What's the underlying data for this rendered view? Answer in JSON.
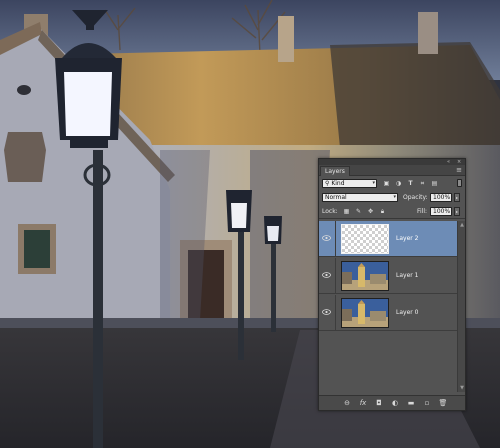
{
  "panel": {
    "title_tab": "Layers",
    "menu_icon": "panel-menu-icon",
    "collapse_icons": [
      "collapse-icon",
      "close-icon"
    ],
    "filter": {
      "kind_label": "Kind",
      "filter_icons": [
        "pixel-filter-icon",
        "adjustment-filter-icon",
        "type-filter-icon",
        "shape-filter-icon",
        "smart-object-filter-icon"
      ]
    },
    "blend": {
      "mode": "Normal",
      "opacity_label": "Opacity:",
      "opacity_value": "100%"
    },
    "lock": {
      "label": "Lock:",
      "icons": [
        "lock-transparent-icon",
        "lock-image-icon",
        "lock-position-icon",
        "lock-all-icon"
      ],
      "fill_label": "Fill:",
      "fill_value": "100%"
    },
    "layers": [
      {
        "name": "Layer 2",
        "selected": true,
        "visible": true,
        "thumb": "transparent"
      },
      {
        "name": "Layer 1",
        "selected": false,
        "visible": true,
        "thumb": "photo"
      },
      {
        "name": "Layer 0",
        "selected": false,
        "visible": true,
        "thumb": "photo"
      }
    ],
    "footer_icons": [
      "link-layers-icon",
      "fx-icon",
      "add-mask-icon",
      "adjustment-layer-icon",
      "new-group-icon",
      "new-layer-icon",
      "trash-icon"
    ],
    "footer_glyphs": {
      "link": "⊖",
      "fx": "fx",
      "mask": "◘",
      "adjust": "◐",
      "group": "▬",
      "newlayer": "▫",
      "trash": "🗑"
    }
  },
  "colors": {
    "panel_bg": "#535353",
    "selected_row": "#6d8cb6",
    "roof": "#b08a4a"
  }
}
